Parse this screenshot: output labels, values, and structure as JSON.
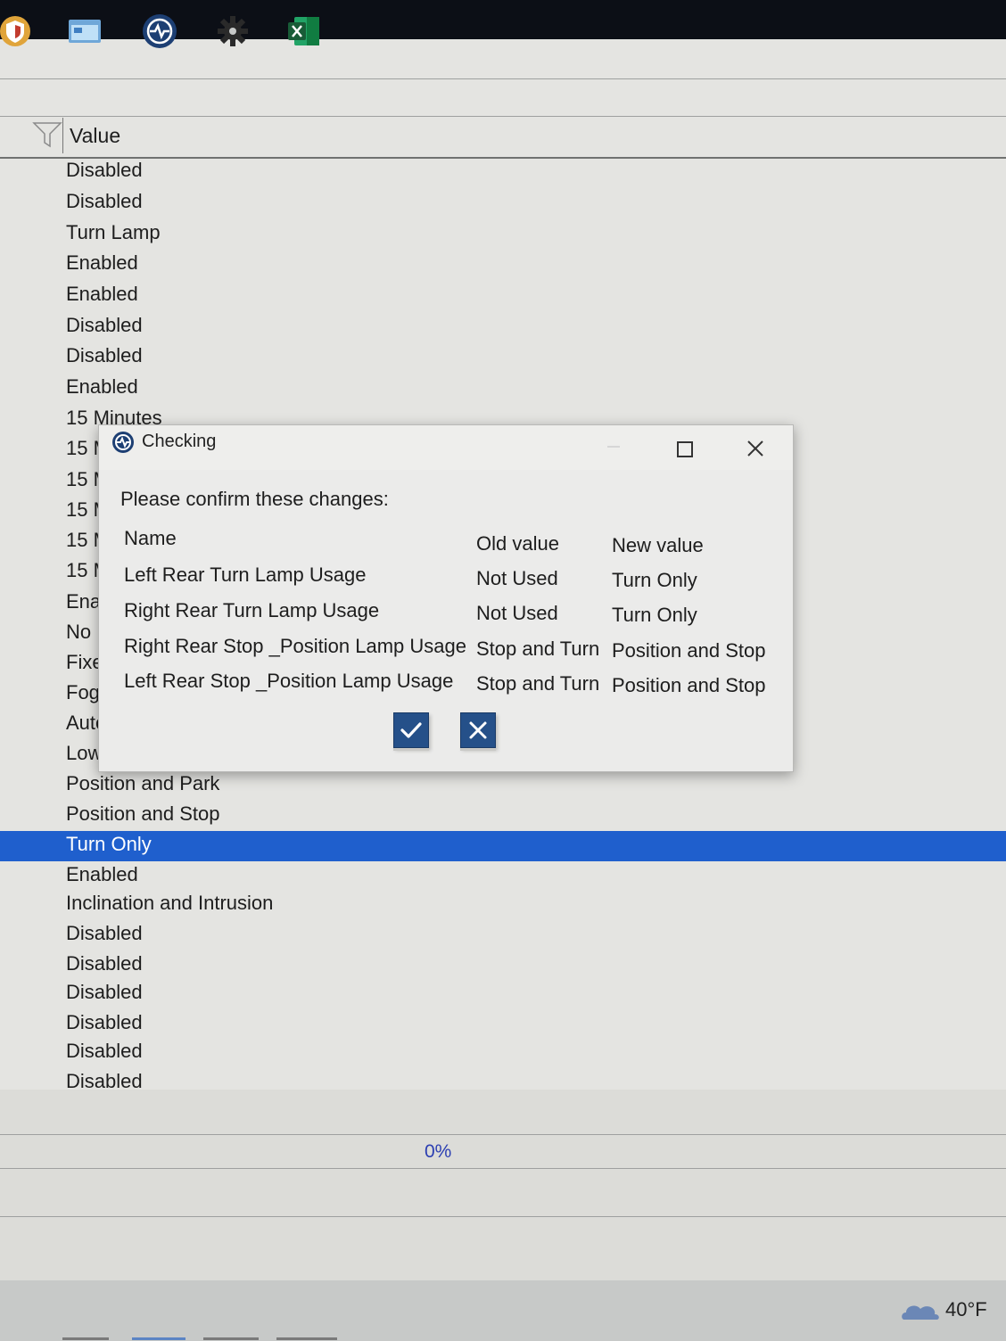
{
  "grid": {
    "column_header": "Value",
    "rows": [
      "Disabled",
      "Disabled",
      "Turn Lamp",
      "Enabled",
      "Enabled",
      "Disabled",
      "Disabled",
      "Enabled",
      "15 Minutes",
      "15 M",
      "15 M",
      "15 M",
      "15 M",
      "15 M",
      "Ena",
      "No I",
      "Fixe",
      "Fog",
      "Auto",
      "Low",
      "Position and Park",
      "Position and Stop",
      "Turn Only",
      "Enabled",
      "Inclination and Intrusion",
      "Disabled",
      "Disabled",
      "Disabled",
      "Disabled",
      "Disabled",
      "Disabled"
    ],
    "selected_row": "Turn Only"
  },
  "progress": {
    "label": "0%",
    "value": 0
  },
  "dialog": {
    "title": "Checking",
    "prompt": "Please confirm these changes:",
    "headers": {
      "name": "Name",
      "old": "Old value",
      "new": "New value"
    },
    "changes": [
      {
        "name": "Left Rear Turn Lamp Usage",
        "old": "Not Used",
        "new": "Turn Only"
      },
      {
        "name": "Right Rear Turn Lamp Usage",
        "old": "Not Used",
        "new": "Turn Only"
      },
      {
        "name": "Right Rear Stop _Position Lamp Usage",
        "old": "Stop and Turn",
        "new": "Position and Stop"
      },
      {
        "name": "Left Rear Stop _Position Lamp Usage",
        "old": "Stop and Turn",
        "new": "Position and Stop"
      }
    ],
    "confirm_icon": "checkmark-icon",
    "cancel_icon": "x-icon"
  },
  "taskbar": {
    "items": [
      "security-shield-icon",
      "explorer-window-icon",
      "diagnostic-app-icon",
      "settings-gear-icon",
      "excel-icon"
    ],
    "weather": {
      "icon": "cloud-icon",
      "temp": "40°F"
    }
  },
  "colors": {
    "selection": "#1f5fcd",
    "dialog_button": "#255089",
    "progress_text": "#2c3fb2"
  }
}
